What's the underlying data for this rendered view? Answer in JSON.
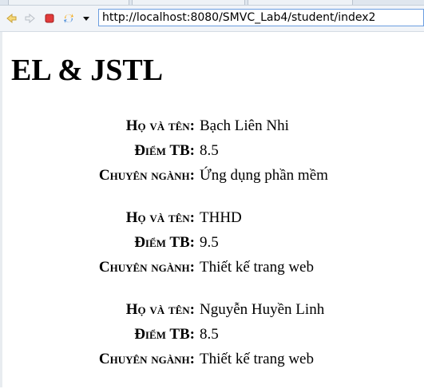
{
  "browser": {
    "url": "http://localhost:8080/SMVC_Lab4/student/index2"
  },
  "page": {
    "heading": "EL & JSTL",
    "labels": {
      "name": "Họ và tên:",
      "score": "Điểm TB:",
      "major": "Chuyên ngành:"
    },
    "students": [
      {
        "name": "Bạch Liên Nhi",
        "score": "8.5",
        "major": "Ứng dụng phần mềm"
      },
      {
        "name": "THHD",
        "score": "9.5",
        "major": "Thiết kế trang web"
      },
      {
        "name": "Nguyễn Huyền Linh",
        "score": "8.5",
        "major": "Thiết kế trang web"
      }
    ]
  }
}
